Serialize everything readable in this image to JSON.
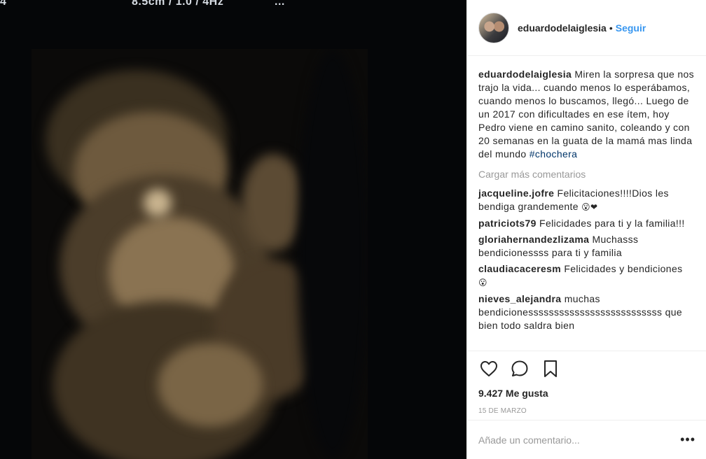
{
  "media": {
    "overlay_left": "4",
    "overlay_scan": "8.5cm / 1.0 / 4Hz",
    "overlay_right": "..."
  },
  "header": {
    "username": "eduardodelaiglesia",
    "separator": "•",
    "follow_label": "Seguir"
  },
  "caption": {
    "username": "eduardodelaiglesia",
    "text": "Miren la sorpresa que nos trajo la vida... cuando menos lo esperábamos, cuando menos lo buscamos, llegó... Luego de un 2017 con dificultades en ese ítem, hoy Pedro viene en camino sanito, coleando y con 20 semanas en la guata de la mamá mas linda del mundo",
    "hashtag": "#chochera"
  },
  "load_more_label": "Cargar más comentarios",
  "comments": [
    {
      "user": "jacqueline.jofre",
      "text": "Felicitaciones!!!!Dios les bendiga grandemente",
      "emoji": "😮❤"
    },
    {
      "user": "patriciots79",
      "text": "Felicidades para ti y la familia!!!",
      "emoji": ""
    },
    {
      "user": "gloriahernandezlizama",
      "text": "Muchasss bendicionessss para ti y familia",
      "emoji": ""
    },
    {
      "user": "claudiacaceresm",
      "text": "Felicidades y bendiciones",
      "emoji": "😮"
    },
    {
      "user": "nieves_alejandra",
      "text": "muchas bendicionessssssssssssssssssssssssss que bien todo saldra bien",
      "emoji": ""
    }
  ],
  "actions": {
    "icons": [
      "heart-icon",
      "comment-icon",
      "bookmark-icon"
    ],
    "likes": "9.427 Me gusta",
    "date": "15 de marzo"
  },
  "add_comment": {
    "placeholder": "Añade un comentario...",
    "more": "•••"
  },
  "colors": {
    "link_blue": "#3897f0",
    "hashtag": "#003569",
    "muted": "#999999",
    "border": "#efefef"
  }
}
